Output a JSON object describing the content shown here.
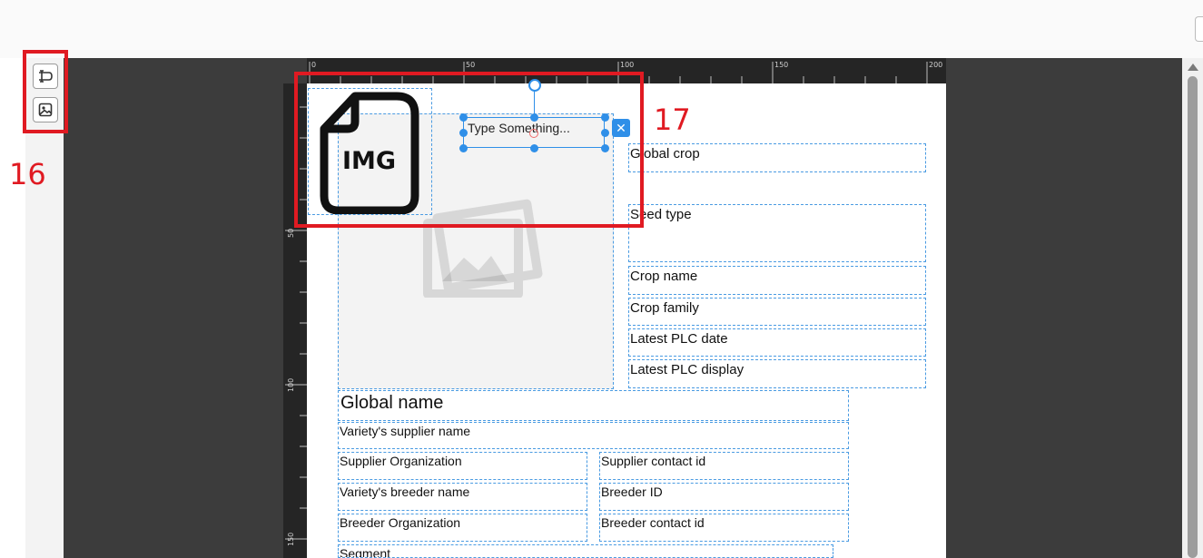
{
  "annotations": {
    "toolbar_label": "16",
    "selection_label": "17"
  },
  "toolbar": {
    "items": [
      {
        "name": "text-tool",
        "icon": "text-cursor-icon"
      },
      {
        "name": "image-tool",
        "icon": "image-icon"
      }
    ]
  },
  "ruler": {
    "top_labels": [
      "0",
      "50",
      "100",
      "150",
      "200"
    ],
    "left_labels": [
      "50",
      "100",
      "150"
    ]
  },
  "canvas": {
    "image_placeholder": {
      "badge_text": "IMG"
    },
    "textbox": {
      "text": "Type Something..."
    },
    "fields": {
      "global_crop": "Global crop",
      "seed_type": "Seed type",
      "crop_name": "Crop name",
      "crop_family": "Crop family",
      "latest_plc_date": "Latest PLC date",
      "latest_plc_display": "Latest PLC display",
      "global_name": "Global name",
      "supplier_name": "Variety's supplier name",
      "supplier_org": "Supplier Organization",
      "supplier_contact": "Supplier contact id",
      "breeder_name": "Variety's breeder name",
      "breeder_id": "Breeder ID",
      "breeder_org": "Breeder Organization",
      "breeder_contact": "Breeder contact id",
      "segment": "Segment"
    }
  },
  "colors": {
    "accent": "#2f8fe8",
    "annotation": "#e01a22",
    "workspace": "#3c3c3c"
  }
}
